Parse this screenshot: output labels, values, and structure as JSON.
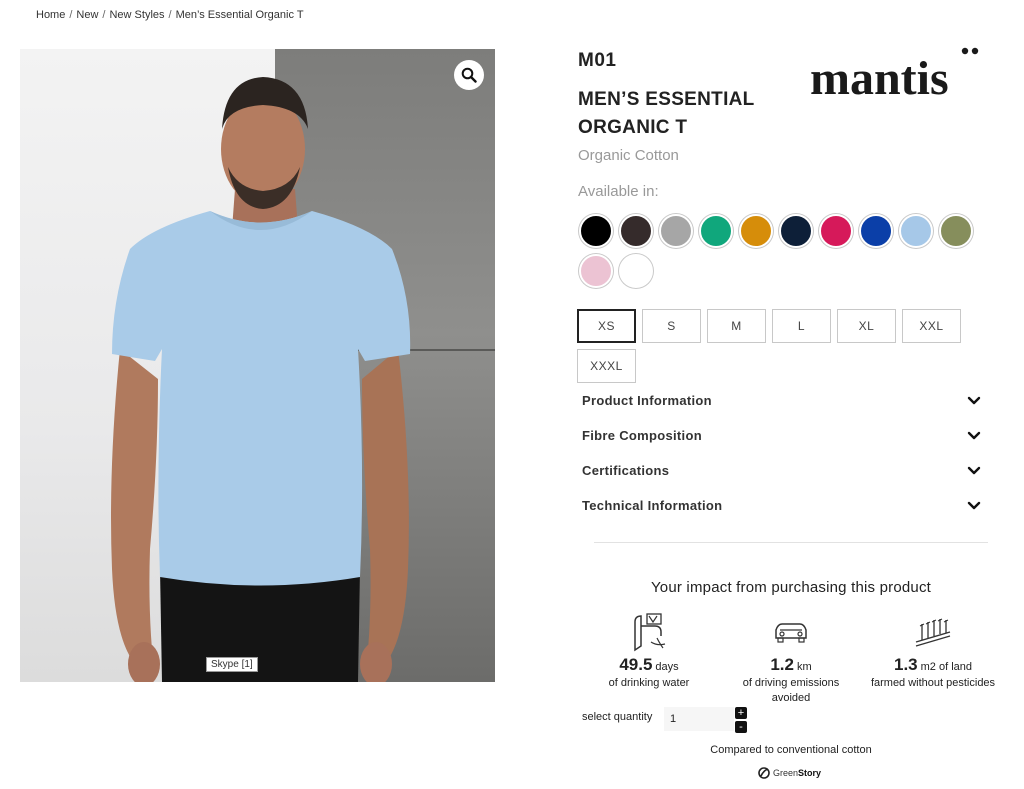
{
  "breadcrumb": {
    "items": [
      "Home",
      "New",
      "New Styles",
      "Men’s Essential Organic T"
    ],
    "separator": "/"
  },
  "image": {
    "zoom_icon": "search-icon",
    "overlay_tag": "Skype [1]"
  },
  "product": {
    "sku": "M01",
    "title_line1": "MEN’S ESSENTIAL",
    "title_line2": "ORGANIC T",
    "material": "Organic Cotton",
    "available_label": "Available in:",
    "brand": "mantis",
    "colors": [
      "#000000",
      "#352b2b",
      "#a6a6a6",
      "#10a77c",
      "#d68d0a",
      "#0d1f38",
      "#d6195a",
      "#0b3fa8",
      "#a6c8e8",
      "#868e5c",
      "#ecc3d3",
      "#ffffff"
    ],
    "sizes": [
      "XS",
      "S",
      "M",
      "L",
      "XL",
      "XXL",
      "XXXL"
    ],
    "selected_size": "XS"
  },
  "accordion": [
    {
      "label": "Product Information",
      "icon": "chevron-down-icon"
    },
    {
      "label": "Fibre Composition",
      "icon": "chevron-down-icon"
    },
    {
      "label": "Certifications",
      "icon": "chevron-down-icon"
    },
    {
      "label": "Technical Information",
      "icon": "chevron-down-icon"
    }
  ],
  "impact": {
    "title": "Your impact from purchasing this product",
    "items": [
      {
        "icon": "water-tap-icon",
        "value": "49.5",
        "unit": "days",
        "desc_line1": "of drinking water",
        "desc_line2": ""
      },
      {
        "icon": "car-icon",
        "value": "1.2",
        "unit": "km",
        "desc_line1": "of driving emissions",
        "desc_line2": "avoided"
      },
      {
        "icon": "field-icon",
        "value": "1.3",
        "unit": "m2 of land",
        "desc_line1": "farmed without pesticides",
        "desc_line2": ""
      }
    ],
    "quantity_label": "select quantity",
    "quantity_value": "1",
    "plus": "+",
    "minus": "-",
    "compared": "Compared to conventional cotton",
    "provider_light": "Green",
    "provider_bold": "Story"
  }
}
